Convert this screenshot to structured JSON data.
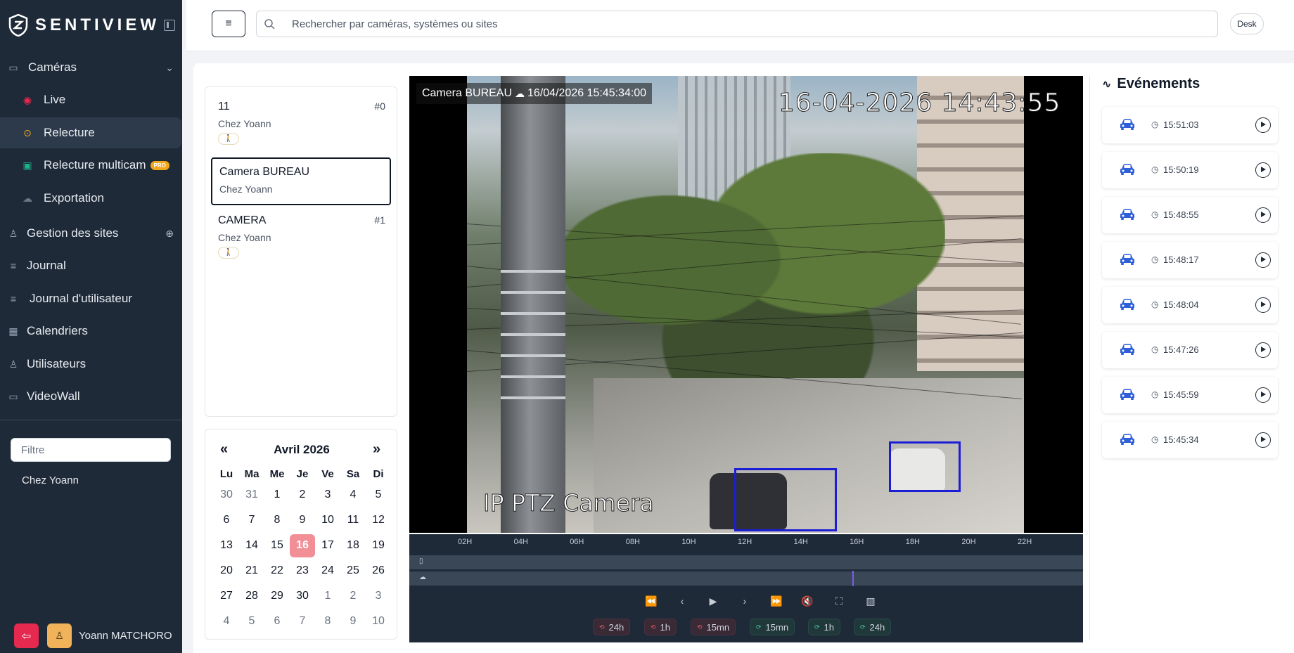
{
  "brand": {
    "name": "SENTIVIEW"
  },
  "sidebar": {
    "items": [
      {
        "label": "Caméras",
        "icon": "camera-icon"
      },
      {
        "label": "Live",
        "icon": "live-icon"
      },
      {
        "label": "Relecture",
        "icon": "replay-icon"
      },
      {
        "label": "Relecture multicam",
        "icon": "multicam-icon",
        "badge": "PRO"
      },
      {
        "label": "Exportation",
        "icon": "cloud-icon"
      },
      {
        "label": "Gestion des sites",
        "icon": "sites-icon"
      },
      {
        "label": "Journal",
        "icon": "list-icon"
      },
      {
        "label": "Journal d'utilisateur",
        "icon": "list-icon"
      },
      {
        "label": "Calendriers",
        "icon": "calendar-icon"
      },
      {
        "label": "Utilisateurs",
        "icon": "user-icon"
      },
      {
        "label": "VideoWall",
        "icon": "monitor-icon"
      }
    ],
    "active_item": "Relecture",
    "filter_placeholder": "Filtre",
    "site": "Chez Yoann",
    "user": {
      "name": "Yoann MATCHORO"
    }
  },
  "topbar": {
    "search_placeholder": "Rechercher par caméras, systèmes ou sites",
    "desk_label": "Desk"
  },
  "cameras": [
    {
      "name": "11",
      "num": "#0",
      "site": "Chez Yoann",
      "has_badge": true
    },
    {
      "name": "Camera BUREAU",
      "num": "",
      "site": "Chez Yoann",
      "selected": true,
      "has_badge": false
    },
    {
      "name": "CAMERA",
      "num": "#1",
      "site": "Chez Yoann",
      "has_badge": true
    }
  ],
  "calendar": {
    "prev": "«",
    "next": "»",
    "month": "Avril 2026",
    "weekdays": [
      "Lu",
      "Ma",
      "Me",
      "Je",
      "Ve",
      "Sa",
      "Di"
    ],
    "weeks": [
      [
        "30",
        "31",
        "1",
        "2",
        "3",
        "4",
        "5"
      ],
      [
        "6",
        "7",
        "8",
        "9",
        "10",
        "11",
        "12"
      ],
      [
        "13",
        "14",
        "15",
        "16",
        "17",
        "18",
        "19"
      ],
      [
        "20",
        "21",
        "22",
        "23",
        "24",
        "25",
        "26"
      ],
      [
        "27",
        "28",
        "29",
        "30",
        "1",
        "2",
        "3"
      ],
      [
        "4",
        "5",
        "6",
        "7",
        "8",
        "9",
        "10"
      ]
    ],
    "today": "16"
  },
  "video": {
    "caption_camera": "Camera BUREAU",
    "caption_datetime": "16/04/2026 15:45:34:00",
    "overlay_timestamp": "16-04-2026 14:43:55",
    "overlay_model": "IP PTZ Camera"
  },
  "timeline": {
    "hours": [
      "02H",
      "04H",
      "06H",
      "08H",
      "10H",
      "12H",
      "14H",
      "16H",
      "18H",
      "20H",
      "22H"
    ],
    "steps_back": [
      "24h",
      "1h",
      "15mn"
    ],
    "steps_forward": [
      "15mn",
      "1h",
      "24h"
    ]
  },
  "events": {
    "title": "Evénements",
    "items": [
      {
        "time": "15:51:03"
      },
      {
        "time": "15:50:19"
      },
      {
        "time": "15:48:55"
      },
      {
        "time": "15:48:17"
      },
      {
        "time": "15:48:04"
      },
      {
        "time": "15:47:26"
      },
      {
        "time": "15:45:59"
      },
      {
        "time": "15:45:34"
      }
    ]
  },
  "colors": {
    "sidebar": "#1e2a38",
    "accent_today": "#f28e96",
    "event_icon": "#2f5fd8",
    "detection_box": "#1d1dd6"
  }
}
